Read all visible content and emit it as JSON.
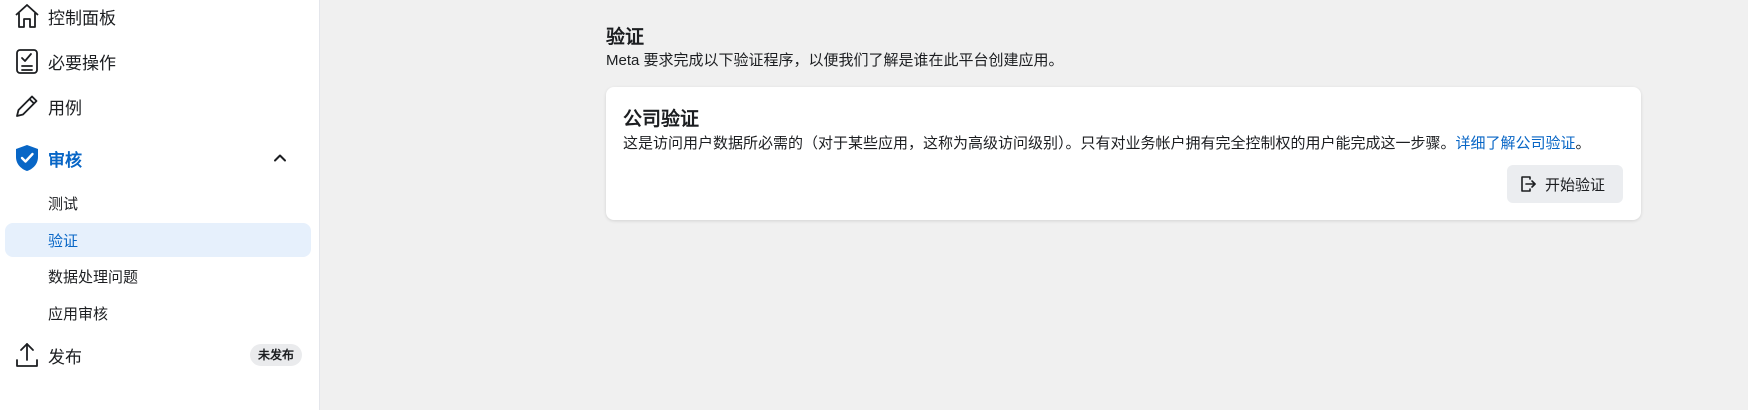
{
  "sidebar": {
    "items": [
      {
        "label": "控制面板",
        "icon": "home-icon"
      },
      {
        "label": "必要操作",
        "icon": "clipboard-check-icon"
      },
      {
        "label": "用例",
        "icon": "pencil-icon"
      },
      {
        "label": "审核",
        "icon": "shield-check-icon",
        "expanded": true
      },
      {
        "label": "发布",
        "icon": "upload-icon",
        "badge": "未发布"
      }
    ],
    "review_subitems": [
      {
        "label": "测试"
      },
      {
        "label": "验证",
        "selected": true
      },
      {
        "label": "数据处理问题"
      },
      {
        "label": "应用审核"
      }
    ]
  },
  "main": {
    "title": "验证",
    "subtitle": "Meta 要求完成以下验证程序，以便我们了解是谁在此平台创建应用。",
    "card": {
      "title": "公司验证",
      "description": "这是访问用户数据所必需的（对于某些应用，这称为高级访问级别）。只有对业务帐户拥有完全控制权的用户能完成这一步骤。",
      "link_text": "详细了解公司验证",
      "trailing": "。",
      "button_label": "开始验证",
      "button_icon": "exit-icon"
    }
  },
  "colors": {
    "accent": "#0866c6",
    "selected_bg": "#e6f0fc",
    "page_bg": "#f0f0f0"
  }
}
